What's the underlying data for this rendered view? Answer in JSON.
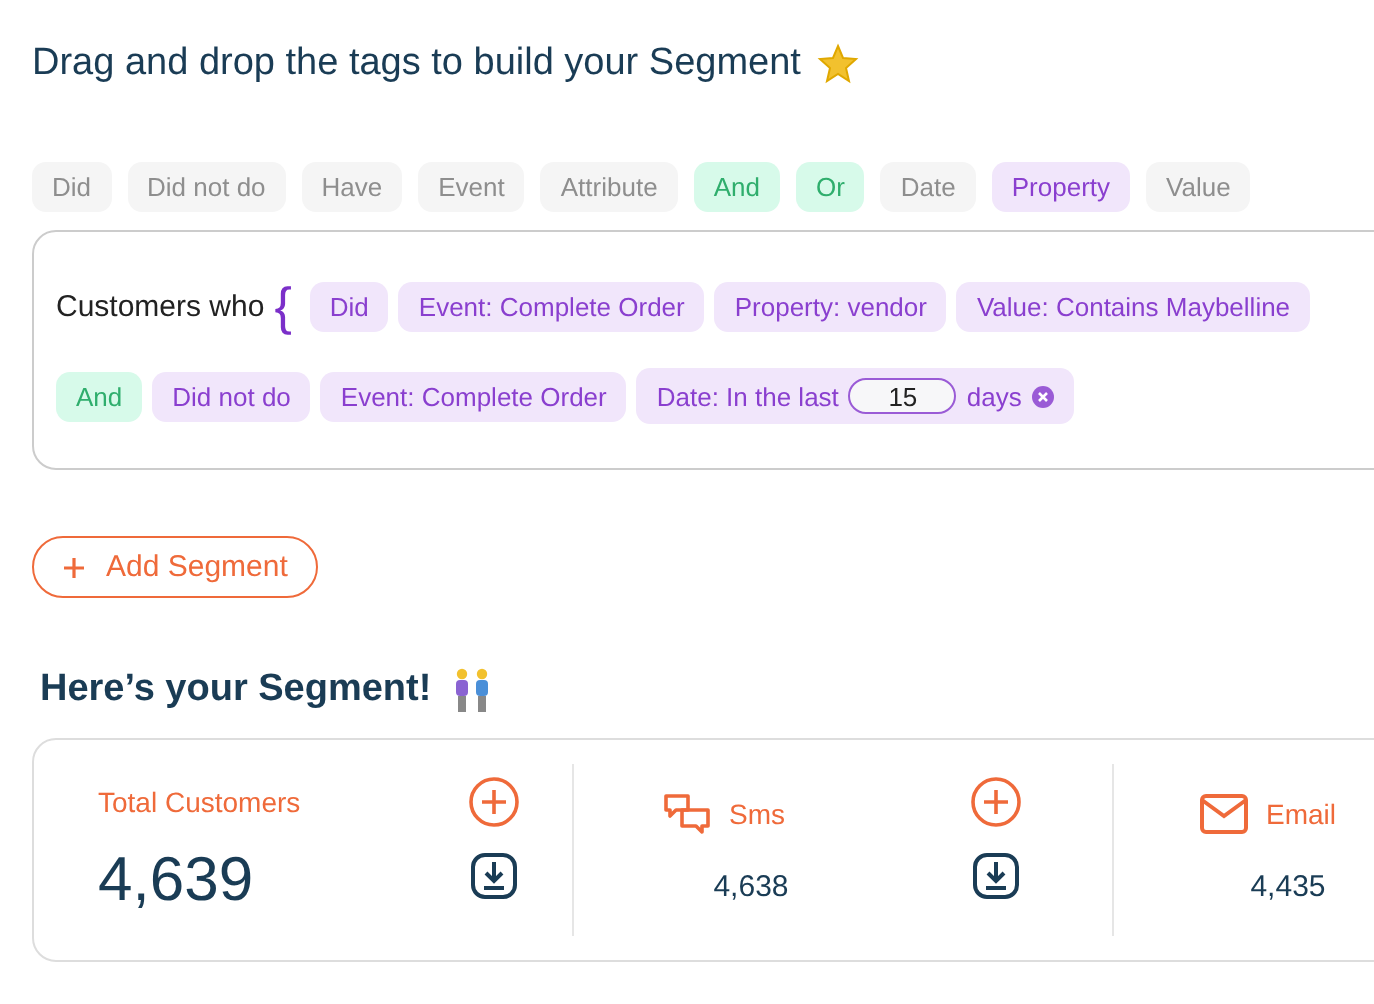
{
  "title": "Drag and drop the tags to build your Segment",
  "palette": [
    {
      "label": "Did",
      "kind": "disabled"
    },
    {
      "label": "Did not do",
      "kind": "disabled"
    },
    {
      "label": "Have",
      "kind": "disabled"
    },
    {
      "label": "Event",
      "kind": "disabled"
    },
    {
      "label": "Attribute",
      "kind": "disabled"
    },
    {
      "label": "And",
      "kind": "logic"
    },
    {
      "label": "Or",
      "kind": "logic"
    },
    {
      "label": "Date",
      "kind": "disabled"
    },
    {
      "label": "Property",
      "kind": "condition"
    },
    {
      "label": "Value",
      "kind": "disabled"
    }
  ],
  "segment": {
    "lead": "Customers who",
    "brace": "{",
    "lines": [
      {
        "tags": [
          {
            "label": "Did",
            "kind": "condition"
          },
          {
            "label": "Event: Complete Order",
            "kind": "condition"
          },
          {
            "label": "Property: vendor",
            "kind": "condition"
          },
          {
            "label": "Value: Contains Maybelline",
            "kind": "condition"
          }
        ]
      },
      {
        "tags": [
          {
            "label": "And",
            "kind": "logic"
          },
          {
            "label": "Did not do",
            "kind": "condition"
          },
          {
            "label": "Event: Complete Order",
            "kind": "condition"
          },
          {
            "label": "Date: In the last",
            "kind": "date",
            "value": "15",
            "suffix": "days"
          }
        ]
      }
    ]
  },
  "add_button": "Add Segment",
  "result_heading": "Here’s your Segment!",
  "stats": [
    {
      "label": "Total Customers",
      "kind": "total",
      "value": "4,639"
    },
    {
      "label": "Sms",
      "kind": "sms",
      "value": "4,638"
    },
    {
      "label": "Email",
      "kind": "email",
      "value": "4,435"
    }
  ]
}
